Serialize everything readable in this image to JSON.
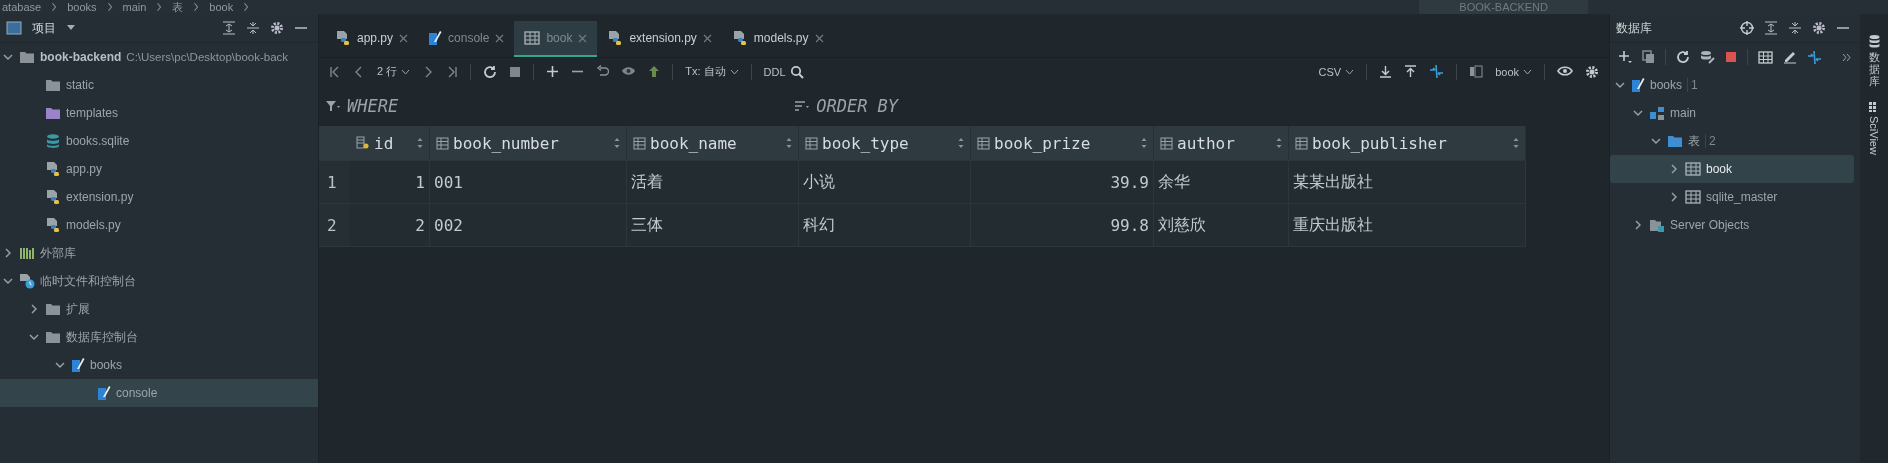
{
  "breadcrumb": [
    "atabase",
    "books",
    "main",
    "表",
    "book"
  ],
  "run_config": "BOOK-BACKEND",
  "project_panel": {
    "title": "项目",
    "tree": [
      {
        "label": "book-backend",
        "note": "C:\\Users\\pc\\Desktop\\book-back",
        "kind": "folder",
        "expanded": true,
        "selected": false,
        "children": [
          {
            "label": "static",
            "kind": "folder",
            "selected": false
          },
          {
            "label": "templates",
            "kind": "template-folder",
            "selected": false
          },
          {
            "label": "books.sqlite",
            "kind": "database",
            "selected": false
          },
          {
            "label": "app.py",
            "kind": "python",
            "selected": false
          },
          {
            "label": "extension.py",
            "kind": "python",
            "selected": false
          },
          {
            "label": "models.py",
            "kind": "python",
            "selected": false
          }
        ]
      },
      {
        "label": "外部库",
        "kind": "library",
        "expanded": false,
        "selected": false
      },
      {
        "label": "临时文件和控制台",
        "kind": "scratch",
        "expanded": true,
        "selected": false,
        "children": [
          {
            "label": "扩展",
            "kind": "folder",
            "expanded": false,
            "selected": false
          },
          {
            "label": "数据库控制台",
            "kind": "folder",
            "expanded": true,
            "selected": false,
            "children": [
              {
                "label": "books",
                "kind": "console",
                "expanded": true,
                "selected": false,
                "children": [
                  {
                    "label": "console",
                    "kind": "console",
                    "selected": true
                  }
                ]
              }
            ]
          }
        ]
      }
    ]
  },
  "tabs": [
    {
      "label": "app.py",
      "kind": "python",
      "selected": false
    },
    {
      "label": "console",
      "kind": "console",
      "selected": false
    },
    {
      "label": "book",
      "kind": "table",
      "selected": true
    },
    {
      "label": "extension.py",
      "kind": "python",
      "selected": false
    },
    {
      "label": "models.py",
      "kind": "python",
      "selected": false
    }
  ],
  "toolbar": {
    "rows": "2 行",
    "tx": "Tx: 自动",
    "ddl": "DDL",
    "format": "CSV",
    "table": "book"
  },
  "filter": {
    "where": "WHERE",
    "order": "ORDER BY"
  },
  "table": {
    "columns": [
      {
        "label": "id",
        "kind": "key"
      },
      {
        "label": "book_number",
        "kind": "text"
      },
      {
        "label": "book_name",
        "kind": "text"
      },
      {
        "label": "book_type",
        "kind": "text"
      },
      {
        "label": "book_prize",
        "kind": "number"
      },
      {
        "label": "author",
        "kind": "text"
      },
      {
        "label": "book_publisher",
        "kind": "text"
      }
    ],
    "rows": [
      {
        "number": "1",
        "cells": [
          "1",
          "001",
          "活着",
          "小说",
          "39.9",
          "余华",
          "某某出版社"
        ]
      },
      {
        "number": "2",
        "cells": [
          "2",
          "002",
          "三体",
          "科幻",
          "99.8",
          "刘慈欣",
          "重庆出版社"
        ]
      }
    ]
  },
  "database_panel": {
    "title": "数据库",
    "tree": [
      {
        "label": "books",
        "badge": "1",
        "kind": "console",
        "expanded": true,
        "selected": false,
        "children": [
          {
            "label": "main",
            "kind": "schema",
            "expanded": true,
            "selected": false,
            "children": [
              {
                "label": "表",
                "badge": "2",
                "kind": "table-folder",
                "expanded": true,
                "selected": false,
                "children": [
                  {
                    "label": "book",
                    "kind": "table",
                    "expanded": false,
                    "selected": true
                  },
                  {
                    "label": "sqlite_master",
                    "kind": "table",
                    "expanded": false,
                    "selected": false
                  }
                ]
              }
            ]
          },
          {
            "label": "Server Objects",
            "kind": "server-objects",
            "expanded": false,
            "selected": false
          }
        ]
      }
    ]
  },
  "side_tabs": [
    "数据库",
    "SciView"
  ]
}
